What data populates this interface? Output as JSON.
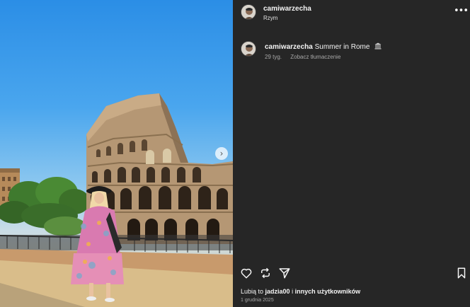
{
  "post": {
    "username": "camiwarzecha",
    "location": "Rzym",
    "more_glyph": "•••",
    "caption": {
      "username": "camiwarzecha",
      "text": "Summer in Rome",
      "emoji_icon": "classical-building-icon",
      "age": "29 tyg.",
      "translate_label": "Zobacz tłumaczenie"
    },
    "likes": {
      "prefix": "Lubią to ",
      "user": "jadzia00",
      "joiner": " i ",
      "others": "innych użytkowników"
    },
    "date": "1 grudnia 2025",
    "photo": {
      "subject": "Colosseum",
      "carousel_next_glyph": "›"
    },
    "actions": [
      "heart-icon",
      "repost-icon",
      "share-icon",
      "bookmark-icon"
    ],
    "colors": {
      "panel": "#262626",
      "text": "#f5f5f5",
      "muted": "#a8a8a8",
      "sky": "#2b8ee6"
    }
  }
}
